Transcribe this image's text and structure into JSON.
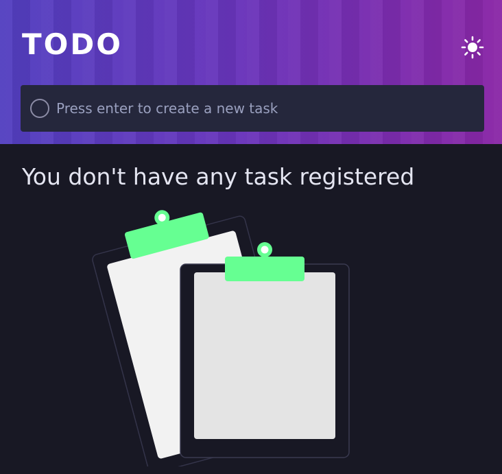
{
  "app": {
    "title": "TODO"
  },
  "header": {
    "theme_toggle_icon": "sun-icon"
  },
  "new_task": {
    "placeholder": "Press enter to create a new task",
    "value": ""
  },
  "empty_state": {
    "message": "You don't have any task registered",
    "illustration_icon": "clipboard-icon"
  },
  "colors": {
    "background": "#181824",
    "input_background": "#25273c",
    "clip_accent": "#66ff92",
    "header_gradient_start": "#5541c8",
    "header_gradient_end": "#9628b4"
  }
}
